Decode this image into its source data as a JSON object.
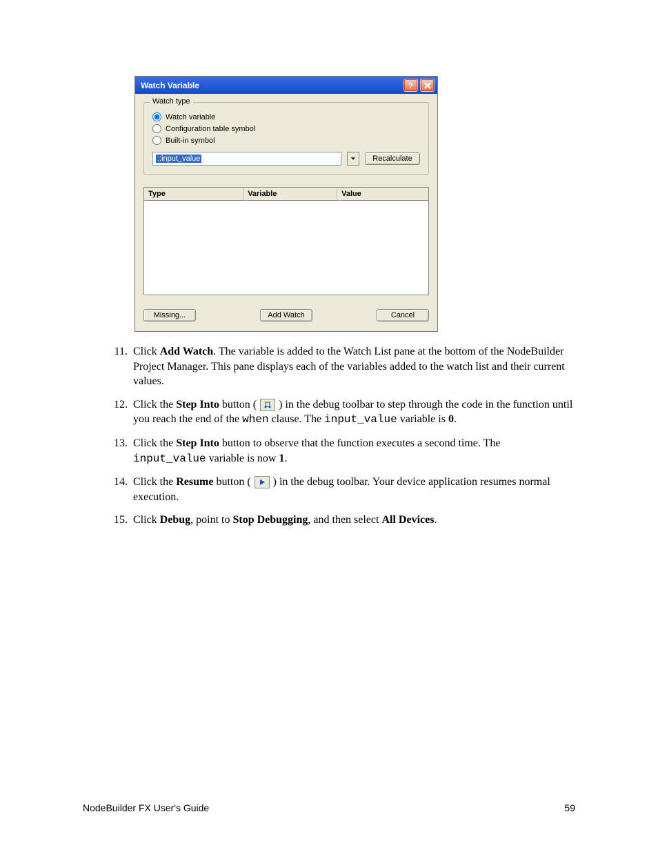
{
  "dialog": {
    "title": "Watch Variable",
    "group_label": "Watch type",
    "radios": {
      "watch_variable": "Watch variable",
      "config_table": "Configuration table symbol",
      "builtin": "Built-in symbol"
    },
    "input_value": "::input_value",
    "recalc_label": "Recalculate",
    "table_headers": {
      "type": "Type",
      "variable": "Variable",
      "value": "Value"
    },
    "buttons": {
      "missing": "Missing...",
      "add_watch": "Add Watch",
      "cancel": "Cancel"
    }
  },
  "steps": {
    "s11": {
      "num": "11.",
      "pre": "Click ",
      "bold1": "Add Watch",
      "post": ".  The variable is added to the Watch List pane at the bottom of the NodeBuilder Project Manager.  This pane displays each of the variables added to the watch list and their current values."
    },
    "s12": {
      "num": "12.",
      "pre": "Click the ",
      "bold1": "Step Into",
      "mid1": " button ( ",
      "mid2": " ) in the debug toolbar to step through the code in the function until you reach the end of the ",
      "code1": "when",
      "mid3": " clause.  The ",
      "code2": "input_value",
      "mid4": " variable is ",
      "bold2": "0",
      "end": "."
    },
    "s13": {
      "num": "13.",
      "pre": "Click the ",
      "bold1": "Step Into",
      "mid1": " button to observe that the function executes a second time.  The ",
      "code1": "input_value",
      "mid2": " variable is now ",
      "bold2": "1",
      "end": "."
    },
    "s14": {
      "num": "14.",
      "pre": "Click the ",
      "bold1": "Resume",
      "mid1": " button ( ",
      "mid2": " ) in the debug toolbar.  Your device application resumes normal execution."
    },
    "s15": {
      "num": "15.",
      "pre": "Click ",
      "bold1": "Debug",
      "mid1": ", point to ",
      "bold2": "Stop Debugging",
      "mid2": ", and then select ",
      "bold3": "All Devices",
      "end": "."
    }
  },
  "footer": {
    "left": "NodeBuilder FX User's Guide",
    "right": "59"
  }
}
